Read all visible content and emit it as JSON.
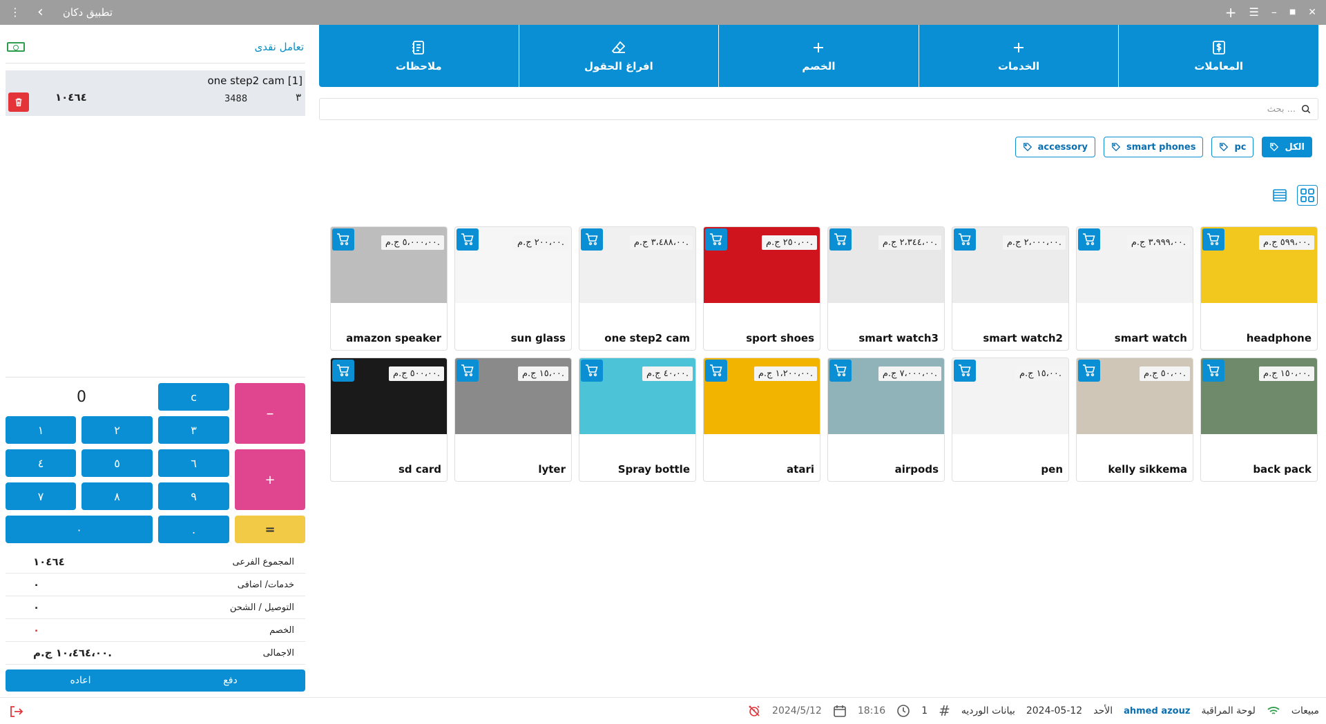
{
  "window": {
    "title": "تطبيق دكان",
    "more_icon": "⋮",
    "back_icon": "‹",
    "add_icon": "+",
    "menu_icon": "☰",
    "minimize_icon": "–",
    "maximize_icon": "■",
    "close_icon": "✕"
  },
  "cart": {
    "payment_mode": "تعامل نقدى",
    "items": [
      {
        "name": "one step2 cam [1]",
        "qty": "٣",
        "unit_price": "3488",
        "line_total": "١٠٤٦٤"
      }
    ]
  },
  "calculator": {
    "display": "0",
    "keys": {
      "clear": "c",
      "minus": "–",
      "plus": "+",
      "equals": "=",
      "k1": "١",
      "k2": "٢",
      "k3": "٣",
      "k4": "٤",
      "k5": "٥",
      "k6": "٦",
      "k7": "٧",
      "k8": "٨",
      "k9": "٩",
      "k0": "٠",
      "dot": "."
    }
  },
  "totals": [
    {
      "label": "المجموع الفرعى",
      "value": "١٠٤٦٤"
    },
    {
      "label": "خدمات/ اضافى",
      "value": "٠"
    },
    {
      "label": "التوصيل / الشحن",
      "value": "٠"
    },
    {
      "label": "الخصم",
      "value": "٠"
    },
    {
      "label": "الاجمالى",
      "value": "١٠،٤٦٤،٠٠ ج.م."
    }
  ],
  "actions": {
    "pay": "دفع",
    "reset": "اعاده"
  },
  "toolbar": {
    "transactions": "المعاملات",
    "services": "الخدمات",
    "discount": "الخصم",
    "clear_fields": "افراغ الحقول",
    "notes": "ملاحظات"
  },
  "search": {
    "placeholder": "بحث ..."
  },
  "categories": [
    {
      "label": "الكل",
      "active": true
    },
    {
      "label": "pc",
      "active": false
    },
    {
      "label": "smart phones",
      "active": false
    },
    {
      "label": "accessory",
      "active": false
    }
  ],
  "products": [
    {
      "name": "headphone",
      "price": "٥٩٩،٠٠ ج.م.",
      "color": "#f2c81e"
    },
    {
      "name": "smart watch",
      "price": "٣،٩٩٩،٠٠ ج.م.",
      "color": "#f2f2f2"
    },
    {
      "name": "smart watch2",
      "price": "٢،٠٠٠،٠٠ ج.م.",
      "color": "#ececec"
    },
    {
      "name": "smart watch3",
      "price": "٢،٣٤٤،٠٠ ج.م.",
      "color": "#e8e8e8"
    },
    {
      "name": "sport shoes",
      "price": "٢٥٠،٠٠ ج.م.",
      "color": "#d0141d"
    },
    {
      "name": "one step2 cam",
      "price": "٣،٤٨٨،٠٠ ج.م.",
      "color": "#f0f0f0"
    },
    {
      "name": "sun glass",
      "price": "٢٠٠،٠٠ ج.م.",
      "color": "#f6f6f6"
    },
    {
      "name": "amazon speaker",
      "price": "٥،٠٠٠،٠٠ ج.م.",
      "color": "#bdbdbd"
    },
    {
      "name": "back pack",
      "price": "١٥٠،٠٠ ج.م.",
      "color": "#6f8a6a"
    },
    {
      "name": "kelly sikkema",
      "price": "٥٠،٠٠ ج.م.",
      "color": "#cfc6b8"
    },
    {
      "name": "pen",
      "price": "١٥،٠٠ ج.م.",
      "color": "#f3f3f3"
    },
    {
      "name": "airpods",
      "price": "٧،٠٠٠،٠٠ ج.م.",
      "color": "#8fb3b8"
    },
    {
      "name": "atari",
      "price": "١،٢٠٠،٠٠ ج.م.",
      "color": "#f3b400"
    },
    {
      "name": "Spray bottle",
      "price": "٤٠،٠٠ ج.م.",
      "color": "#4cc3d6"
    },
    {
      "name": "lyter",
      "price": "١٥،٠٠ ج.م.",
      "color": "#8a8a8a"
    },
    {
      "name": "sd card",
      "price": "٥٠٠،٠٠ ج.م.",
      "color": "#1a1a1a"
    }
  ],
  "status": {
    "sales": "مبيعات",
    "dashboard": "لوحة المراقبة",
    "user": "ahmed azouz",
    "day": "الأحد",
    "date": "2024-05-12",
    "shift_data": "بيانات الورديه",
    "shift_no": "1",
    "time": "18:16",
    "cal_date": "2024/5/12"
  },
  "colors": {
    "primary": "#0a8fd4",
    "pink": "#e0458f",
    "yellow": "#f2ca45",
    "danger": "#e3343a"
  }
}
